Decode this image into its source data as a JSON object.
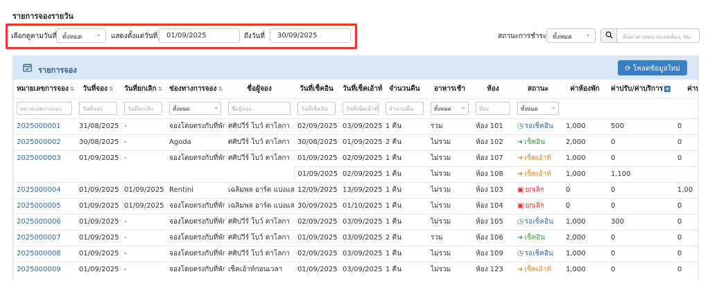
{
  "page_title": "รายการจองรายวัน",
  "filter": {
    "select_date_label": "เลือกดูตามวันที่ :",
    "select_date_value": "ทั้งหมด",
    "from_label": "แสดงตั้งแต่วันที่",
    "from_value": "01/09/2025",
    "to_label": "ถึงวันที่",
    "to_value": "30/09/2025",
    "payment_label": "สถานะการชำระ :",
    "payment_value": "ทั้งหมด",
    "search_placeholder": "ค้นหาตามหมายเลขห้อง, หม"
  },
  "panel": {
    "title": "รายการจอง",
    "reload_label": "โหลดข้อมูลใหม่"
  },
  "columns": [
    "หมายเลขการจอง",
    "วันที่จอง",
    "วันที่ยกเลิก",
    "ช่องทางการจอง",
    "ชื่อผู้จอง",
    "วันที่เช็คอิน",
    "วันที่เช็คเอ้าท์",
    "จำนวนคืน",
    "อาหารเช้า",
    "ห้อง",
    "สถานะ",
    "ค่าห้องพัก",
    "ค่าปรับ/ค่าบริการ",
    "ค่าบ"
  ],
  "column_filters": {
    "booking_no": "หมายเลขการจอง",
    "booking_date": "วันที่จอง",
    "cancel_date": "วันที่ยกเลิก",
    "channel": "ทั้งหมด",
    "guest": "ชื่อผู้จอง",
    "checkin": "วันที่เช็คอิน",
    "checkout": "วันที่เช็คเอ้าท์",
    "nights": "จำนวนคืน",
    "breakfast": "ทั้งหมด",
    "room": "ห้อง",
    "status": "ทั้งหมด"
  },
  "rows": [
    [
      "2025000001",
      "31/08/2025",
      "-",
      "จองโดยตรงกับที่พัก",
      "ศศิปวีร์ โบว์ ตาโลกา",
      "02/09/2025",
      "03/09/2025",
      "1 คืน",
      "รวม",
      "ห้อง 101",
      "รอเช็คอิน",
      "1,000",
      "500",
      "0"
    ],
    [
      "2025000002",
      "30/08/2025",
      "-",
      "Agoda",
      "ศศิปวีร์ โบว์ ตาโลกา",
      "30/08/2025",
      "01/09/2025",
      "2 คืน",
      "ไม่รวม",
      "ห้อง 102",
      "เช็คอิน",
      "2,000",
      "0",
      "0"
    ],
    [
      "2025000003",
      "01/09/2025",
      "-",
      "จองโดยตรงกับที่พัก",
      "ศศิปวีร์ โบว์ ตาโลกา",
      "01/09/2025",
      "02/09/2025",
      "1 คืน",
      "ไม่รวม",
      "ห้อง 107",
      "เช็คเอ้าท์",
      "1,000",
      "0",
      "0"
    ],
    [
      "",
      "",
      "",
      "",
      "",
      "01/09/2025",
      "02/09/2025",
      "1 คืน",
      "ไม่รวม",
      "ห้อง 108",
      "เช็คเอ้าท์",
      "1,000",
      "1,100",
      ""
    ],
    [
      "2025000004",
      "01/09/2025",
      "01/09/2025",
      "Rentini",
      "เฉลิมพล อาร์ต แปงแสง",
      "12/09/2025",
      "13/09/2025",
      "1 คืน",
      "ไม่รวม",
      "ห้อง 103",
      "ยกเลิก",
      "0",
      "0",
      "1,00"
    ],
    [
      "2025000005",
      "01/09/2025",
      "01/09/2025",
      "จองโดยตรงกับที่พัก",
      "เฉลิมพล อาร์ต แปงแสง",
      "30/09/2025",
      "01/10/2025",
      "1 คืน",
      "ไม่รวม",
      "ห้อง 104",
      "ยกเลิก",
      "0",
      "0",
      "0"
    ],
    [
      "2025000006",
      "01/09/2025",
      "-",
      "จองโดยตรงกับที่พัก",
      "ศศิปวีร์ โบว์ ตาโลกา",
      "02/09/2025",
      "03/09/2025",
      "1 คืน",
      "ไม่รวม",
      "ห้อง 105",
      "รอเช็คอิน",
      "1,000",
      "300",
      "0"
    ],
    [
      "2025000007",
      "01/09/2025",
      "-",
      "จองโดยตรงกับที่พัก",
      "ศศิปวีร์ โบว์ ตาโลกา",
      "01/09/2025",
      "03/09/2025",
      "2 คืน",
      "รวม",
      "ห้อง 106",
      "เช็คอิน",
      "2,000",
      "0",
      "0"
    ],
    [
      "2025000008",
      "01/09/2025",
      "-",
      "จองโดยตรงกับที่พัก",
      "ศศิปวีร์ โบว์ ตาโลกา",
      "02/09/2025",
      "03/09/2025",
      "1 คืน",
      "ไม่รวม",
      "ห้อง 109",
      "รอเช็คอิน",
      "1,000",
      "0",
      "0"
    ],
    [
      "2025000009",
      "01/09/2025",
      "-",
      "จองโดยตรงกับที่พัก",
      "เช็คเอ้าท์ก่อนเวลา",
      "01/09/2025",
      "03/09/2025",
      "1 คืน",
      "ไม่รวม",
      "ห้อง 123",
      "เช็คเอ้าท์",
      "1,000",
      "0",
      "0"
    ]
  ],
  "status_icons": {
    "รอเช็คอิน": "clock-icon",
    "เช็คอิน": "sign-in-icon",
    "เช็คเอ้าท์": "sign-out-icon",
    "ยกเลิก": "calendar-x-icon"
  },
  "colors": {
    "link": "#2f6fb5",
    "highlight_border": "#e8382c",
    "panel_header": "#dae7f4",
    "reload_button": "#3a7fc6"
  }
}
